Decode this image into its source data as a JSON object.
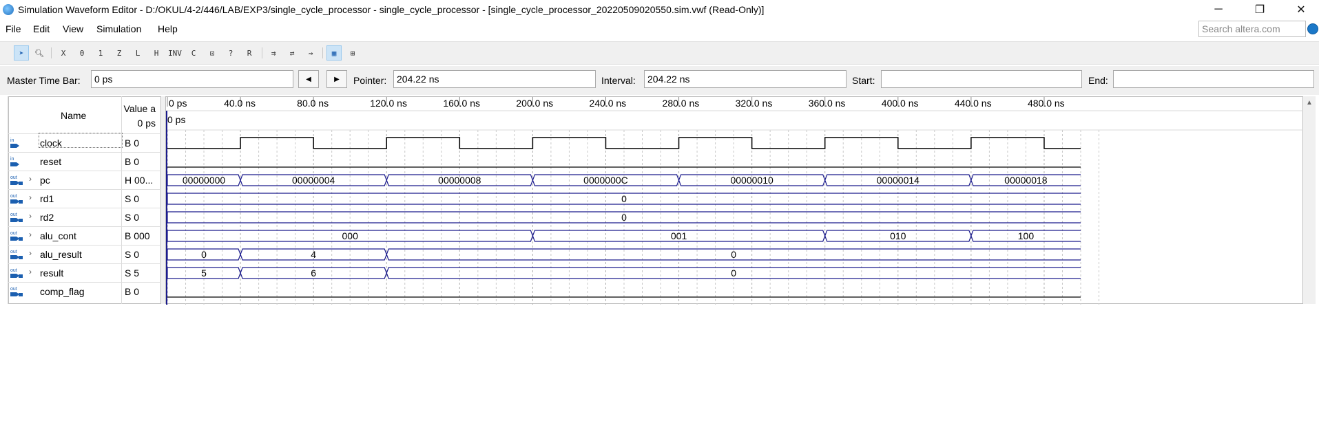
{
  "window": {
    "title": "Simulation Waveform Editor - D:/OKUL/4-2/446/LAB/EXP3/single_cycle_processor - single_cycle_processor - [single_cycle_processor_20220509020550.sim.vwf (Read-Only)]",
    "minimize_glyph": "─",
    "restore_glyph": "❐",
    "close_glyph": "✕"
  },
  "menu": [
    {
      "label": "File"
    },
    {
      "label": "Edit"
    },
    {
      "label": "View"
    },
    {
      "label": "Simulation"
    },
    {
      "label": "Help"
    }
  ],
  "search": {
    "placeholder": "Search altera.com"
  },
  "toolbar": {
    "icons": [
      "select-icon",
      "zoom-icon",
      "uninitialized-icon",
      "force-low-icon",
      "force-high-icon",
      "high-impedance-icon",
      "weak-low-icon",
      "weak-high-icon",
      "invert-icon",
      "count-value-icon",
      "clock-value-icon",
      "arbitrary-value-icon",
      "random-value-icon",
      "snap-grid-icon",
      "snap-transition-icon",
      "trace-icon",
      "grid-icon",
      "overwrite-icon"
    ]
  },
  "timebar": {
    "master_label": "Master Time Bar:",
    "master_value": "0 ps",
    "prev_glyph": "◀",
    "next_glyph": "▶",
    "pointer_label": "Pointer:",
    "pointer_value": "204.22 ns",
    "interval_label": "Interval:",
    "interval_value": "204.22 ns",
    "start_label": "Start:",
    "start_value": "",
    "end_label": "End:",
    "end_value": ""
  },
  "header": {
    "name": "Name",
    "value_line1": "Value a",
    "value_line2": "0 ps",
    "time_marker": "0 ps"
  },
  "time_scale": {
    "unit": "ns",
    "ticks": [
      "0 ps",
      "40.0 ns",
      "80.0 ns",
      "120.0 ns",
      "160.0 ns",
      "200.0 ns",
      "240.0 ns",
      "280.0 ns",
      "320.0 ns",
      "360.0 ns",
      "400.0 ns",
      "440.0 ns",
      "480.0 ns"
    ],
    "clock_period_ns": 80
  },
  "signals": [
    {
      "name": "clock",
      "direction": "in",
      "value": "B 0",
      "type": "clock"
    },
    {
      "name": "reset",
      "direction": "in",
      "value": "B 0",
      "type": "const_low"
    },
    {
      "name": "pc",
      "direction": "out",
      "value": "H 00...",
      "type": "bus",
      "segments": [
        {
          "start": 0,
          "end": 40,
          "label": "00000000"
        },
        {
          "start": 40,
          "end": 120,
          "label": "00000004"
        },
        {
          "start": 120,
          "end": 200,
          "label": "00000008"
        },
        {
          "start": 200,
          "end": 280,
          "label": "0000000C"
        },
        {
          "start": 280,
          "end": 360,
          "label": "00000010"
        },
        {
          "start": 360,
          "end": 440,
          "label": "00000014"
        },
        {
          "start": 440,
          "end": 500,
          "label": "00000018"
        }
      ]
    },
    {
      "name": "rd1",
      "direction": "out",
      "value": "S 0",
      "type": "bus",
      "segments": [
        {
          "start": 0,
          "end": 500,
          "label": "0"
        }
      ]
    },
    {
      "name": "rd2",
      "direction": "out",
      "value": "S 0",
      "type": "bus",
      "segments": [
        {
          "start": 0,
          "end": 500,
          "label": "0"
        }
      ]
    },
    {
      "name": "alu_cont",
      "direction": "out",
      "value": "B 000",
      "type": "bus",
      "segments": [
        {
          "start": 0,
          "end": 200,
          "label": "000"
        },
        {
          "start": 200,
          "end": 360,
          "label": "001"
        },
        {
          "start": 360,
          "end": 440,
          "label": "010"
        },
        {
          "start": 440,
          "end": 500,
          "label": "100"
        }
      ]
    },
    {
      "name": "alu_result",
      "direction": "out",
      "value": "S 0",
      "type": "bus",
      "segments": [
        {
          "start": 0,
          "end": 40,
          "label": "0"
        },
        {
          "start": 40,
          "end": 120,
          "label": "4"
        },
        {
          "start": 120,
          "end": 500,
          "label": "0"
        }
      ]
    },
    {
      "name": "result",
      "direction": "out",
      "value": "S 5",
      "type": "bus",
      "segments": [
        {
          "start": 0,
          "end": 40,
          "label": "5"
        },
        {
          "start": 40,
          "end": 120,
          "label": "6"
        },
        {
          "start": 120,
          "end": 500,
          "label": "0"
        }
      ]
    },
    {
      "name": "comp_flag",
      "direction": "out",
      "value": "B 0",
      "type": "const_low"
    }
  ],
  "colors": {
    "bus": "#1a1a8c",
    "clock": "#000000",
    "cursor": "#1a1a8c"
  }
}
